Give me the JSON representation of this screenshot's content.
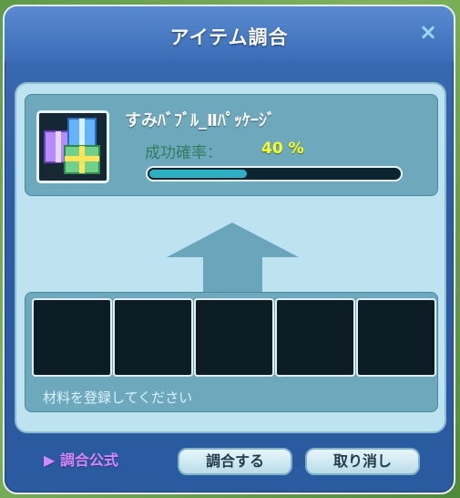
{
  "window": {
    "title": "アイテム調合",
    "close_glyph": "×"
  },
  "item": {
    "name": "すみﾊﾞﾌﾞﾙ_Ⅱﾊﾟｯｹｰｼﾞ",
    "success_label": "成功確率：",
    "success_value": "40 %",
    "success_fraction": 0.4,
    "icon": "gift-box-package-icon"
  },
  "materials": {
    "slot_count": 5,
    "hint": "材料を登録してください"
  },
  "footer": {
    "formula_label": "▶ 調合公式",
    "mix_button": "調合する",
    "cancel_button": "取り消し"
  },
  "colors": {
    "accent": "#2db1c2",
    "success_value": "#f6ff3a",
    "formula": "#d08bff"
  }
}
